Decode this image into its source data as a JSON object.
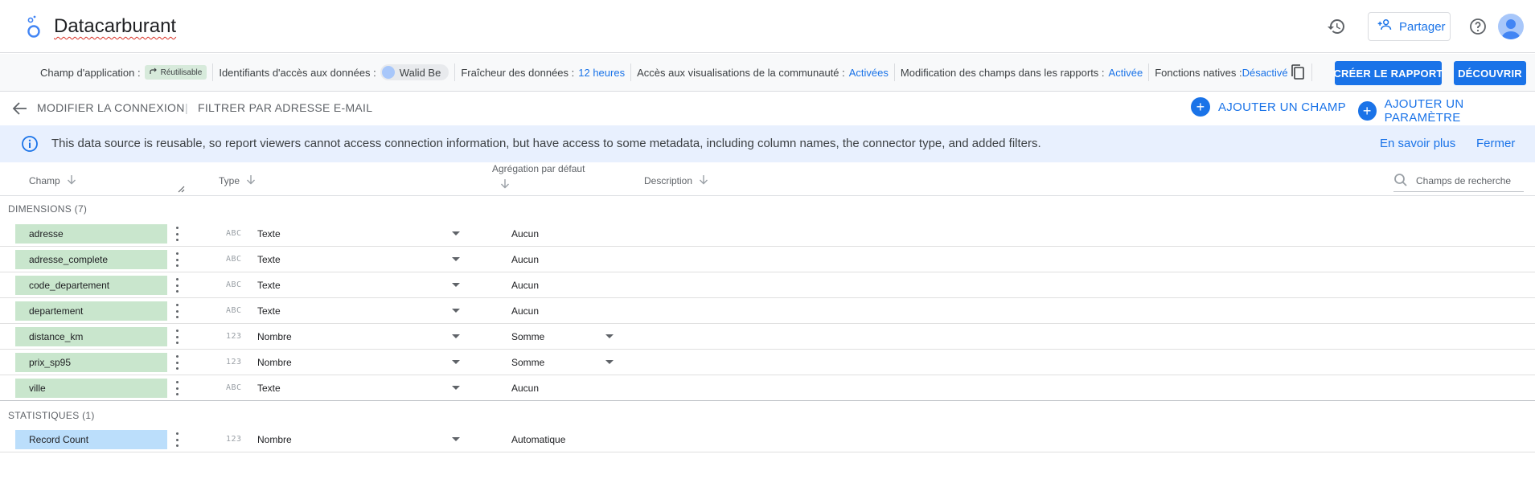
{
  "app": {
    "title": "Datacarburant",
    "share_label": "Partager"
  },
  "infostrip": {
    "champ_app_label": "Champ d'application :",
    "champ_app_chip": "Réutilisable",
    "credentials_label": "Identifiants d'accès aux données :",
    "credentials_user": "Walid Be",
    "freshness_label": "Fraîcheur des données :",
    "freshness_value": "12 heures",
    "community_label": "Accès aux visualisations de la communauté :",
    "community_value": "Activées",
    "edit_fields_label": "Modification des champs dans les rapports :",
    "edit_fields_value": "Activée",
    "native_label": "Fonctions natives :",
    "native_value": "Désactivé",
    "create_report": "CRÉER LE RAPPORT",
    "discover": "DÉCOUVRIR"
  },
  "actionbar": {
    "modify_connection": "MODIFIER LA CONNEXION",
    "separator": "|",
    "filter_email": "FILTRER PAR ADRESSE E-MAIL",
    "add_field": "AJOUTER UN CHAMP",
    "add_param": "AJOUTER UN PARAMÈTRE"
  },
  "banner": {
    "text": "This data source is reusable, so report viewers cannot access connection information, but have access to some metadata, including column names, the connector type, and added filters.",
    "learn_more": "En savoir plus",
    "close": "Fermer"
  },
  "table": {
    "headers": {
      "champ": "Champ",
      "type": "Type",
      "aggregation": "Agrégation par défaut",
      "description": "Description"
    },
    "search_placeholder": "Champs de recherche",
    "dimensions_label": "DIMENSIONS (7)",
    "metrics_label": "STATISTIQUES (1)",
    "dimensions": [
      {
        "name": "adresse",
        "type_icon": "ABC",
        "type": "Texte",
        "aggregation": "Aucun"
      },
      {
        "name": "adresse_complete",
        "type_icon": "ABC",
        "type": "Texte",
        "aggregation": "Aucun"
      },
      {
        "name": "code_departement",
        "type_icon": "ABC",
        "type": "Texte",
        "aggregation": "Aucun"
      },
      {
        "name": "departement",
        "type_icon": "ABC",
        "type": "Texte",
        "aggregation": "Aucun"
      },
      {
        "name": "distance_km",
        "type_icon": "123",
        "type": "Nombre",
        "aggregation": "Somme"
      },
      {
        "name": "prix_sp95",
        "type_icon": "123",
        "type": "Nombre",
        "aggregation": "Somme"
      },
      {
        "name": "ville",
        "type_icon": "ABC",
        "type": "Texte",
        "aggregation": "Aucun"
      }
    ],
    "metrics": [
      {
        "name": "Record Count",
        "type_icon": "123",
        "type": "Nombre",
        "aggregation": "Automatique"
      }
    ]
  },
  "colors": {
    "accent": "#1a73e8",
    "dimension_chip": "#c9e6cd",
    "metric_chip": "#bbdefb",
    "banner_bg": "#e8f0fe"
  }
}
